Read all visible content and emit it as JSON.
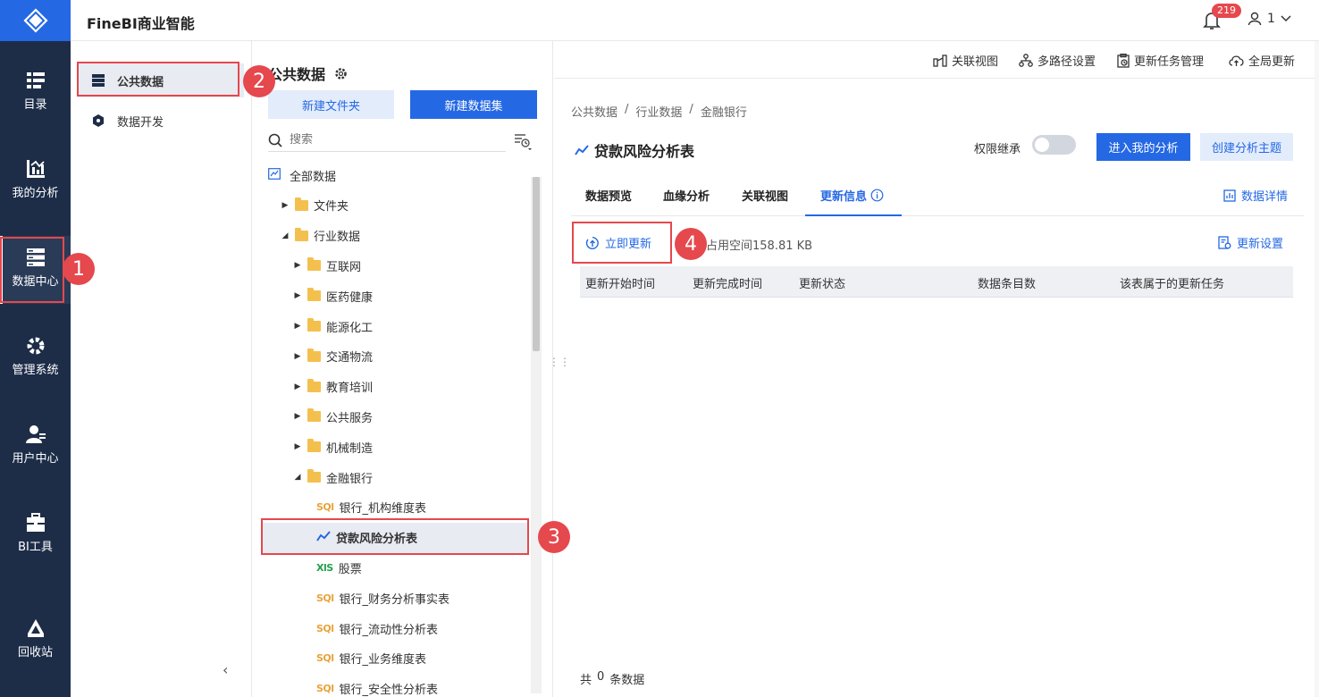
{
  "app": {
    "brand": "FineBI商业智能",
    "notification_count": "219",
    "user_name": "1"
  },
  "rail": [
    {
      "label": "目录",
      "icon": "catalog-icon"
    },
    {
      "label": "我的分析",
      "icon": "analysis-icon"
    },
    {
      "label": "数据中心",
      "icon": "data-center-icon"
    },
    {
      "label": "管理系统",
      "icon": "settings-gear-icon"
    },
    {
      "label": "用户中心",
      "icon": "user-center-icon"
    },
    {
      "label": "BI工具",
      "icon": "toolbox-icon"
    },
    {
      "label": "回收站",
      "icon": "recycle-icon"
    }
  ],
  "nav2": {
    "public_data": "公共数据",
    "data_dev": "数据开发"
  },
  "tree": {
    "title": "公共数据",
    "new_folder": "新建文件夹",
    "new_dataset": "新建数据集",
    "search_placeholder": "搜索",
    "rows": [
      {
        "label": "全部数据",
        "kind": "root"
      },
      {
        "label": "文件夹",
        "kind": "folder"
      },
      {
        "label": "行业数据",
        "kind": "folder-open"
      },
      {
        "label": "互联网",
        "kind": "folder"
      },
      {
        "label": "医药健康",
        "kind": "folder"
      },
      {
        "label": "能源化工",
        "kind": "folder"
      },
      {
        "label": "交通物流",
        "kind": "folder"
      },
      {
        "label": "教育培训",
        "kind": "folder"
      },
      {
        "label": "公共服务",
        "kind": "folder"
      },
      {
        "label": "机械制造",
        "kind": "folder"
      },
      {
        "label": "金融银行",
        "kind": "folder-open"
      },
      {
        "label": "银行_机构维度表",
        "kind": "sql"
      },
      {
        "label": "贷款风险分析表",
        "kind": "analysis"
      },
      {
        "label": "股票",
        "kind": "xls"
      },
      {
        "label": "银行_财务分析事实表",
        "kind": "sql"
      },
      {
        "label": "银行_流动性分析表",
        "kind": "sql"
      },
      {
        "label": "银行_业务维度表",
        "kind": "sql"
      },
      {
        "label": "银行_安全性分析表",
        "kind": "sql"
      }
    ]
  },
  "toolbar": {
    "relation_view": "关联视图",
    "multipath": "多路径设置",
    "task_mgmt": "更新任务管理",
    "global_update": "全局更新"
  },
  "main": {
    "breadcrumb": [
      "公共数据",
      "行业数据",
      "金融银行"
    ],
    "breadcrumb_sep": "/",
    "title": "贷款风险分析表",
    "permission_inherit": "权限继承",
    "enter_analysis": "进入我的分析",
    "create_theme": "创建分析主题",
    "tabs": [
      "数据预览",
      "血缘分析",
      "关联视图",
      "更新信息"
    ],
    "data_details": "数据详情",
    "update_now": "立即更新",
    "space_usage": "占用空间158.81 KB",
    "update_settings": "更新设置",
    "columns": [
      "更新开始时间",
      "更新完成时间",
      "更新状态",
      "数据条目数",
      "该表属于的更新任务"
    ],
    "footer": {
      "prefix": "共",
      "count": "0",
      "suffix": "条数据"
    }
  },
  "callouts": [
    "1",
    "2",
    "3",
    "4"
  ],
  "colors": {
    "primary": "#2468e4",
    "rail": "#1d2d48",
    "callout": "#e5484d",
    "folder": "#f4c04d"
  }
}
